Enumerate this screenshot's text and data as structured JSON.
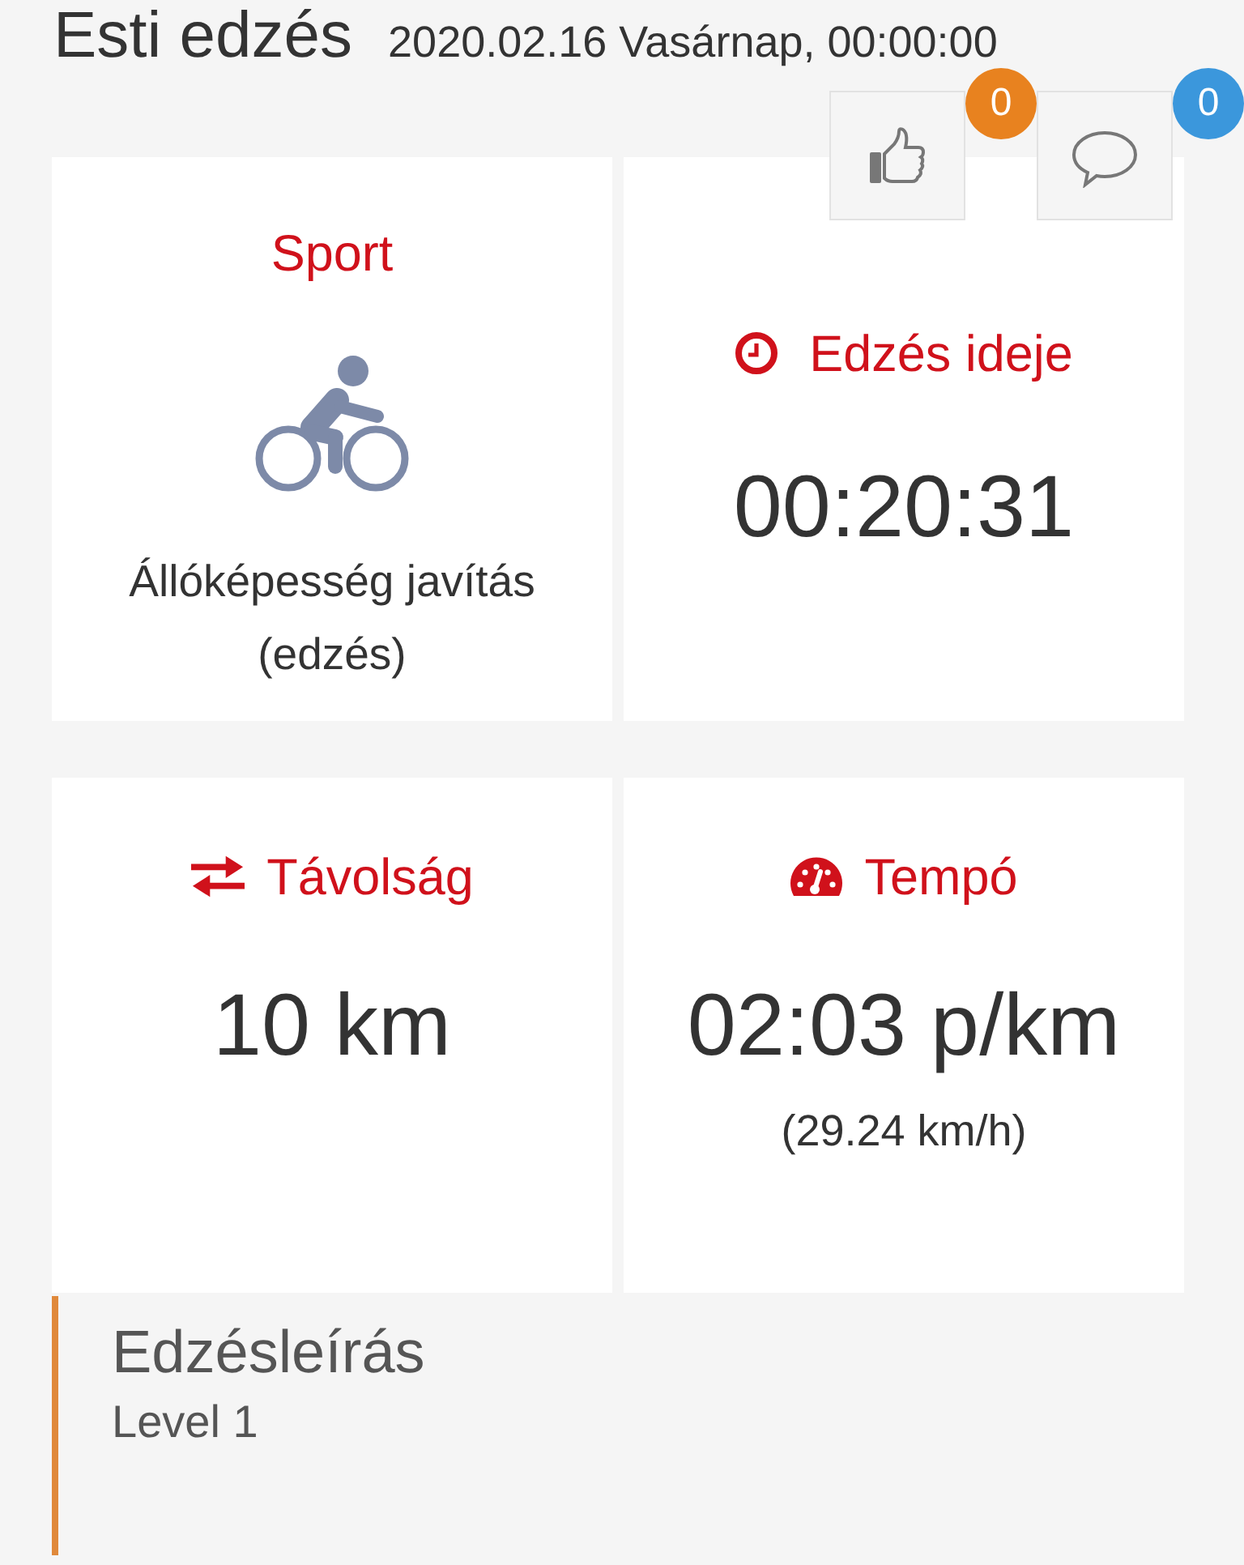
{
  "workout": {
    "title": "Esti edzés",
    "datetime": "2020.02.16 Vasárnap, 00:00:00"
  },
  "actions": [
    {
      "kind": "like",
      "count": "0",
      "color": "#e8821f"
    },
    {
      "kind": "comment",
      "count": "0",
      "color": "#3b97dc"
    }
  ],
  "stats": [
    {
      "kind": "sport",
      "label": "Sport",
      "value": "Állóképesség javítás (edzés)"
    },
    {
      "kind": "duration",
      "label": "Edzés ideje",
      "value": "00:20:31"
    },
    {
      "kind": "distance",
      "label": "Távolság",
      "value": "10 km"
    },
    {
      "kind": "pace",
      "label": "Tempó",
      "value": "02:03 p/km",
      "sub": "(29.24 km/h)"
    }
  ],
  "description": {
    "title": "Edzésleírás",
    "text": "Level 1"
  }
}
